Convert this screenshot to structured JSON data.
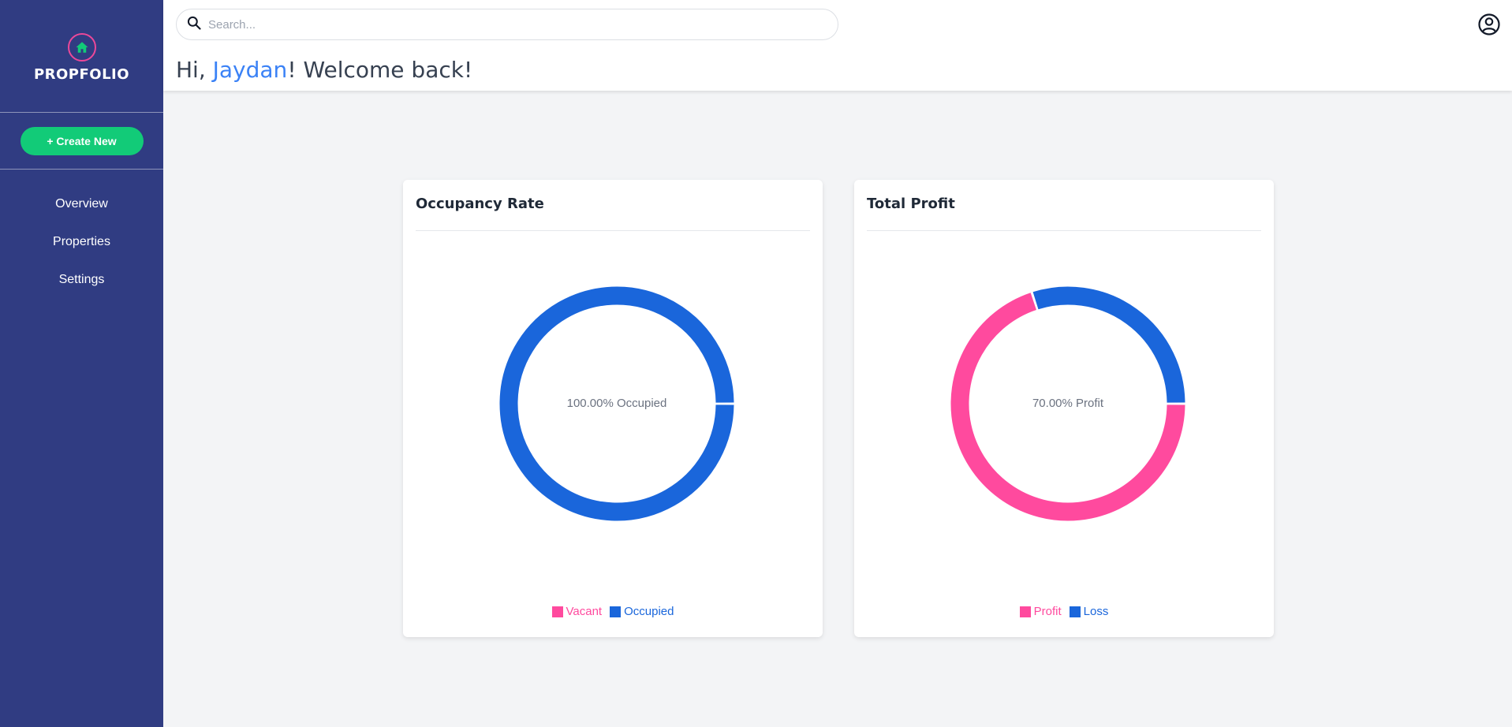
{
  "brand": {
    "name": "PROPFOLIO",
    "logo_icon": "house-icon"
  },
  "sidebar": {
    "create_button": "+ Create New",
    "items": [
      {
        "label": "Overview"
      },
      {
        "label": "Properties"
      },
      {
        "label": "Settings"
      }
    ]
  },
  "header": {
    "search_placeholder": "Search...",
    "greeting_prefix": "Hi, ",
    "user_name": "Jaydan",
    "greeting_suffix": "! Welcome back!",
    "account_icon": "account-circle-icon"
  },
  "colors": {
    "sidebar": "#303c82",
    "accent_green": "#12cb78",
    "pink": "#ff4a9e",
    "blue": "#1a66db",
    "name_blue": "#3b82f6"
  },
  "chart_data": [
    {
      "type": "pie",
      "title": "Occupancy Rate",
      "center_label": "100.00% Occupied",
      "legend_position": "bottom",
      "series": [
        {
          "name": "Vacant",
          "value": 0,
          "color": "#ff4a9e"
        },
        {
          "name": "Occupied",
          "value": 100,
          "color": "#1a66db"
        }
      ]
    },
    {
      "type": "pie",
      "title": "Total Profit",
      "center_label": "70.00% Profit",
      "legend_position": "bottom",
      "series": [
        {
          "name": "Profit",
          "value": 70,
          "color": "#ff4a9e"
        },
        {
          "name": "Loss",
          "value": 30,
          "color": "#1a66db"
        }
      ]
    }
  ]
}
